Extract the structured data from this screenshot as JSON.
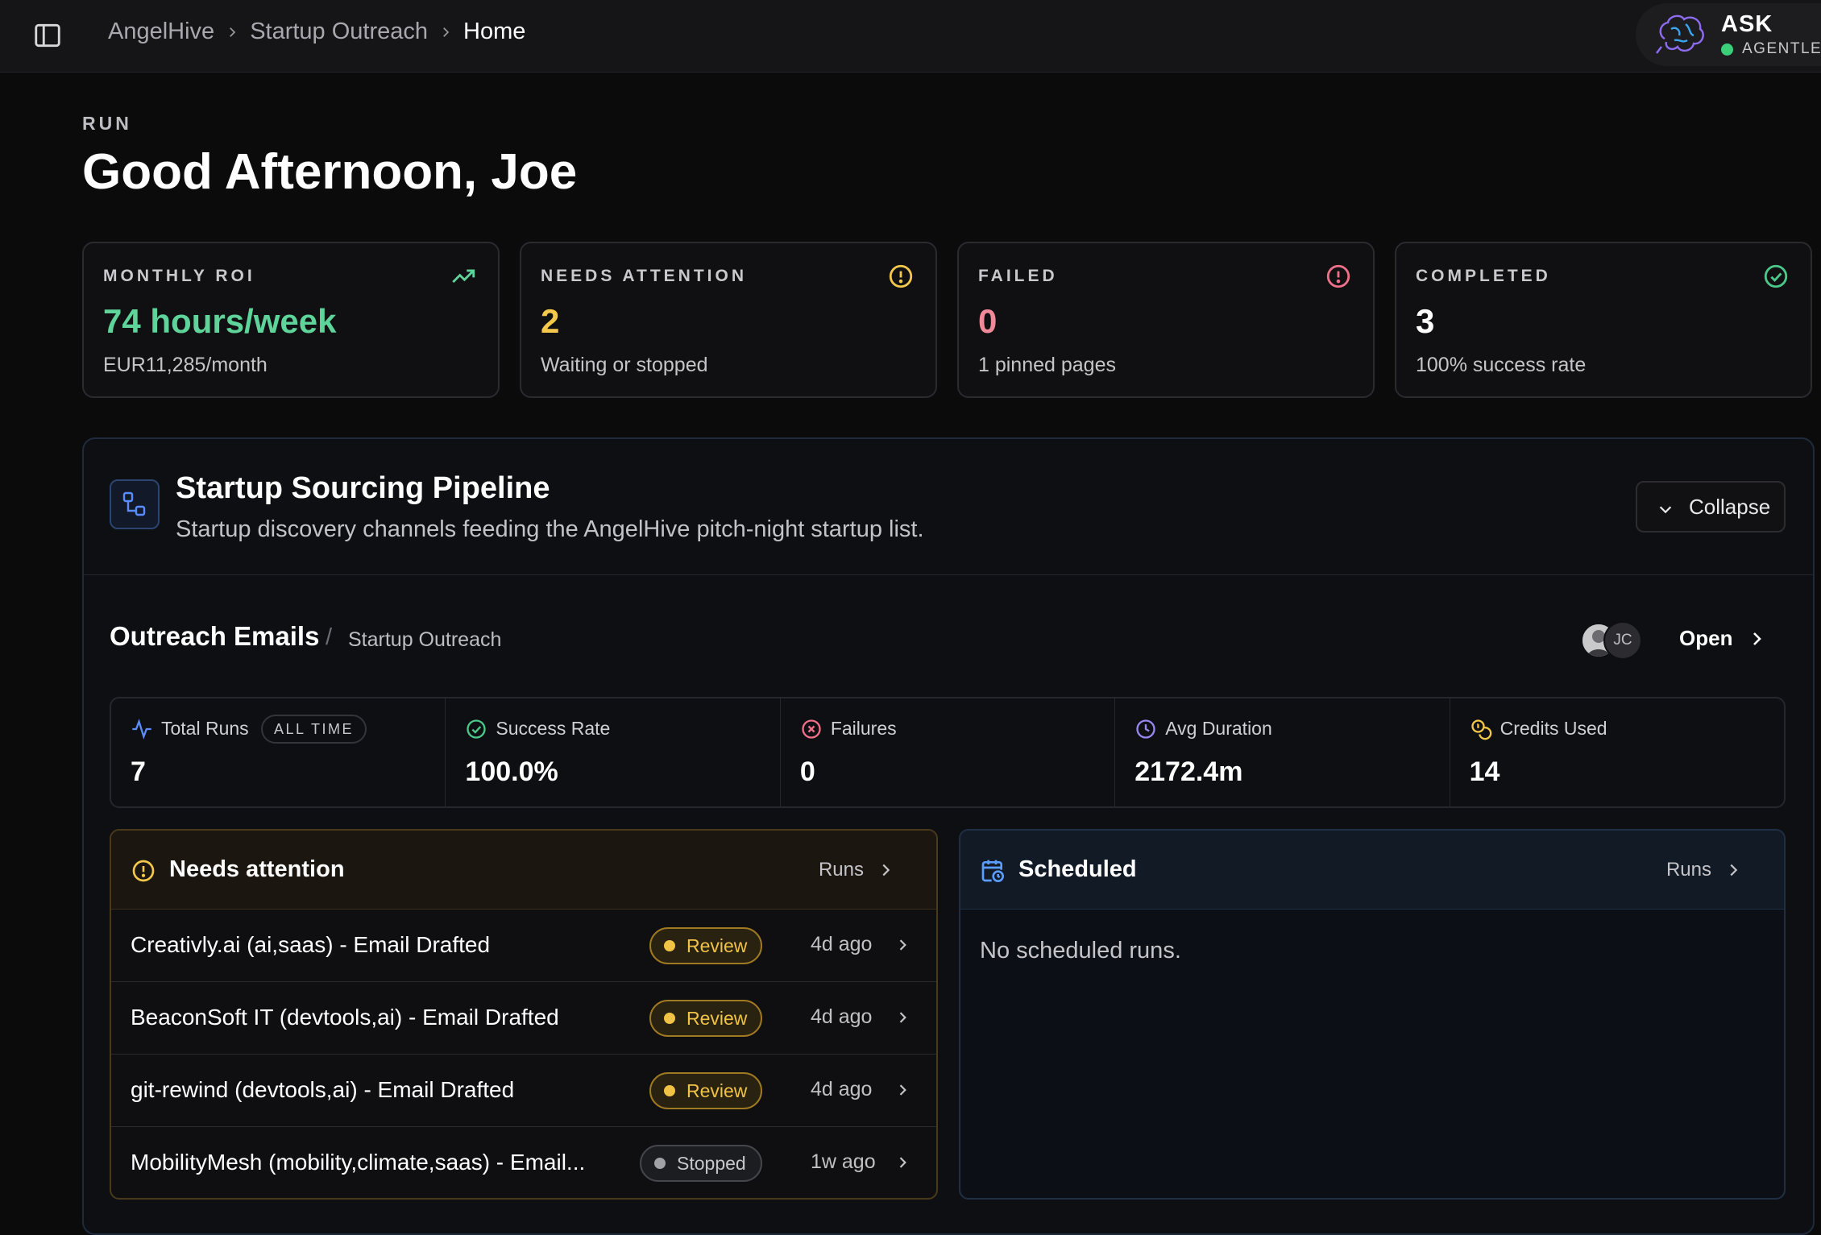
{
  "breadcrumb": [
    "AngelHive",
    "Startup Outreach",
    "Home"
  ],
  "ask": {
    "title": "ASK",
    "status": "AGENTLED"
  },
  "header": {
    "eyebrow": "RUN",
    "greeting": "Good Afternoon, Joe"
  },
  "stats": [
    {
      "label": "MONTHLY ROI",
      "value": "74 hours/week",
      "sub": "EUR11,285/month",
      "icon": "trending-up-icon",
      "color": "#5fd49a"
    },
    {
      "label": "NEEDS ATTENTION",
      "value": "2",
      "sub": "Waiting or stopped",
      "icon": "alert-circle-icon",
      "color": "#f4c84a"
    },
    {
      "label": "FAILED",
      "value": "0",
      "sub": "1 pinned pages",
      "icon": "alert-circle-icon",
      "color": "#f08a9b"
    },
    {
      "label": "COMPLETED",
      "value": "3",
      "sub": "100% success rate",
      "icon": "check-circle-icon",
      "color": "#ffffff"
    }
  ],
  "pipeline": {
    "title": "Startup Sourcing Pipeline",
    "description": "Startup discovery channels feeding the AngelHive pitch-night startup list.",
    "collapse_label": "Collapse"
  },
  "section": {
    "title": "Outreach Emails",
    "separator": "/",
    "subtitle": "Startup Outreach",
    "avatar_initials": "JC",
    "open_label": "Open"
  },
  "metrics": [
    {
      "label": "Total Runs",
      "pill": "ALL TIME",
      "value": "7",
      "icon": "activity-icon"
    },
    {
      "label": "Success Rate",
      "value": "100.0%",
      "icon": "check-circle-icon"
    },
    {
      "label": "Failures",
      "value": "0",
      "icon": "x-circle-icon"
    },
    {
      "label": "Avg Duration",
      "value": "2172.4m",
      "icon": "clock-icon"
    },
    {
      "label": "Credits Used",
      "value": "14",
      "icon": "coins-icon"
    }
  ],
  "attention": {
    "title": "Needs attention",
    "link": "Runs",
    "rows": [
      {
        "title": "Creativly.ai (ai,saas) - Email Drafted",
        "status": "Review",
        "time": "4d ago"
      },
      {
        "title": "BeaconSoft IT (devtools,ai) - Email Drafted",
        "status": "Review",
        "time": "4d ago"
      },
      {
        "title": "git-rewind (devtools,ai) - Email Drafted",
        "status": "Review",
        "time": "4d ago"
      },
      {
        "title": "MobilityMesh (mobility,climate,saas) - Email...",
        "status": "Stopped",
        "time": "1w ago"
      }
    ]
  },
  "scheduled": {
    "title": "Scheduled",
    "link": "Runs",
    "empty": "No scheduled runs."
  }
}
